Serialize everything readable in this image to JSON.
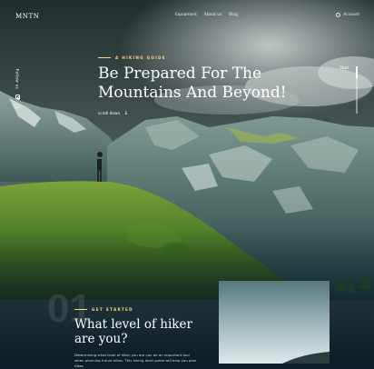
{
  "nav": {
    "logo": "MNTN",
    "links": [
      "Equipment",
      "About us",
      "Blog"
    ],
    "account_label": "Account"
  },
  "social": {
    "follow_label": "Follow us"
  },
  "slider": {
    "start_label": "Start",
    "progress": 0.25
  },
  "hero": {
    "eyebrow": "A HIKING GUIDE",
    "title_line1": "Be Prepared For The",
    "title_line2": "Mountains And Beyond!",
    "scroll_label": "scroll down"
  },
  "section": {
    "number": "01",
    "eyebrow": "GET STARTED",
    "title_line1": "What level of  hiker",
    "title_line2": "are you?",
    "body": "Determining what level of hiker you are can be an important tool when planning future hikes. This hiking level guide will help you plan hikes"
  },
  "colors": {
    "accent": "#fbd784",
    "background": "#0b1d26"
  }
}
